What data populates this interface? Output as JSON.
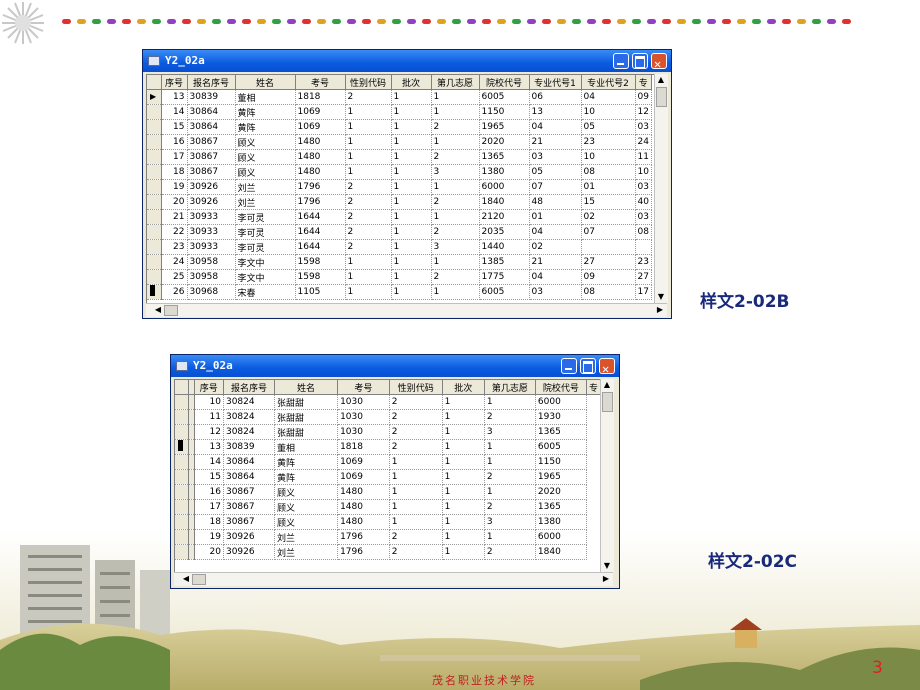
{
  "slide": {
    "page_number": "3",
    "school_name": "茂名职业技术学院",
    "dot_colors": [
      "#e03030",
      "#e0a020",
      "#30a040",
      "#9040c0",
      "#e03030",
      "#e0a020",
      "#30a040",
      "#9040c0",
      "#e03030",
      "#e0a020",
      "#30a040",
      "#9040c0",
      "#e03030",
      "#e0a020",
      "#30a040",
      "#9040c0",
      "#e03030",
      "#e0a020",
      "#30a040",
      "#9040c0",
      "#e03030",
      "#e0a020",
      "#30a040",
      "#9040c0",
      "#e03030",
      "#e0a020",
      "#30a040",
      "#9040c0",
      "#e03030",
      "#e0a020",
      "#30a040",
      "#9040c0",
      "#e03030",
      "#e0a020",
      "#30a040",
      "#9040c0",
      "#e03030",
      "#e0a020",
      "#30a040",
      "#9040c0",
      "#e03030",
      "#e0a020",
      "#30a040",
      "#9040c0",
      "#e03030",
      "#e0a020",
      "#30a040",
      "#9040c0",
      "#e03030",
      "#e0a020",
      "#30a040",
      "#9040c0",
      "#e03030"
    ]
  },
  "window_b": {
    "title": "Y2_02a",
    "caption": "样文2-02B",
    "columns": [
      "序号",
      "报名序号",
      "姓名",
      "考号",
      "性别代码",
      "批次",
      "第几志愿",
      "院校代号",
      "专业代号1",
      "专业代号2",
      "专"
    ],
    "rows": [
      [
        "13",
        "30839",
        "董相",
        "1818",
        "2",
        "1",
        "1",
        "6005",
        "06",
        "04",
        "09"
      ],
      [
        "14",
        "30864",
        "黄阵",
        "1069",
        "1",
        "1",
        "1",
        "1150",
        "13",
        "10",
        "12"
      ],
      [
        "15",
        "30864",
        "黄阵",
        "1069",
        "1",
        "1",
        "2",
        "1965",
        "04",
        "05",
        "03"
      ],
      [
        "16",
        "30867",
        "顾义",
        "1480",
        "1",
        "1",
        "1",
        "2020",
        "21",
        "23",
        "24"
      ],
      [
        "17",
        "30867",
        "顾义",
        "1480",
        "1",
        "1",
        "2",
        "1365",
        "03",
        "10",
        "11"
      ],
      [
        "18",
        "30867",
        "顾义",
        "1480",
        "1",
        "1",
        "3",
        "1380",
        "05",
        "08",
        "10"
      ],
      [
        "19",
        "30926",
        "刘兰",
        "1796",
        "2",
        "1",
        "1",
        "6000",
        "07",
        "01",
        "03"
      ],
      [
        "20",
        "30926",
        "刘兰",
        "1796",
        "2",
        "1",
        "2",
        "1840",
        "48",
        "15",
        "40"
      ],
      [
        "21",
        "30933",
        "李可灵",
        "1644",
        "2",
        "1",
        "1",
        "2120",
        "01",
        "02",
        "03"
      ],
      [
        "22",
        "30933",
        "李可灵",
        "1644",
        "2",
        "1",
        "2",
        "2035",
        "04",
        "07",
        "08"
      ],
      [
        "23",
        "30933",
        "李可灵",
        "1644",
        "2",
        "1",
        "3",
        "1440",
        "02",
        "",
        ""
      ],
      [
        "24",
        "30958",
        "李文中",
        "1598",
        "1",
        "1",
        "1",
        "1385",
        "21",
        "27",
        "23"
      ],
      [
        "25",
        "30958",
        "李文中",
        "1598",
        "1",
        "1",
        "2",
        "1775",
        "04",
        "09",
        "27"
      ],
      [
        "26",
        "30968",
        "宋春",
        "1105",
        "1",
        "1",
        "1",
        "6005",
        "03",
        "08",
        "17"
      ]
    ]
  },
  "window_c": {
    "title": "Y2_02a",
    "caption": "样文2-02C",
    "columns": [
      "序号",
      "报名序号",
      "姓名",
      "考号",
      "性别代码",
      "批次",
      "第几志愿",
      "院校代号",
      "专"
    ],
    "rows": [
      [
        "10",
        "30824",
        "张甜甜",
        "1030",
        "2",
        "1",
        "1",
        "6000"
      ],
      [
        "11",
        "30824",
        "张甜甜",
        "1030",
        "2",
        "1",
        "2",
        "1930"
      ],
      [
        "12",
        "30824",
        "张甜甜",
        "1030",
        "2",
        "1",
        "3",
        "1365"
      ],
      [
        "13",
        "30839",
        "董相",
        "1818",
        "2",
        "1",
        "1",
        "6005"
      ],
      [
        "14",
        "30864",
        "黄阵",
        "1069",
        "1",
        "1",
        "1",
        "1150"
      ],
      [
        "15",
        "30864",
        "黄阵",
        "1069",
        "1",
        "1",
        "2",
        "1965"
      ],
      [
        "16",
        "30867",
        "顾义",
        "1480",
        "1",
        "1",
        "1",
        "2020"
      ],
      [
        "17",
        "30867",
        "顾义",
        "1480",
        "1",
        "1",
        "2",
        "1365"
      ],
      [
        "18",
        "30867",
        "顾义",
        "1480",
        "1",
        "1",
        "3",
        "1380"
      ],
      [
        "19",
        "30926",
        "刘兰",
        "1796",
        "2",
        "1",
        "1",
        "6000"
      ],
      [
        "20",
        "30926",
        "刘兰",
        "1796",
        "2",
        "1",
        "2",
        "1840"
      ]
    ]
  }
}
